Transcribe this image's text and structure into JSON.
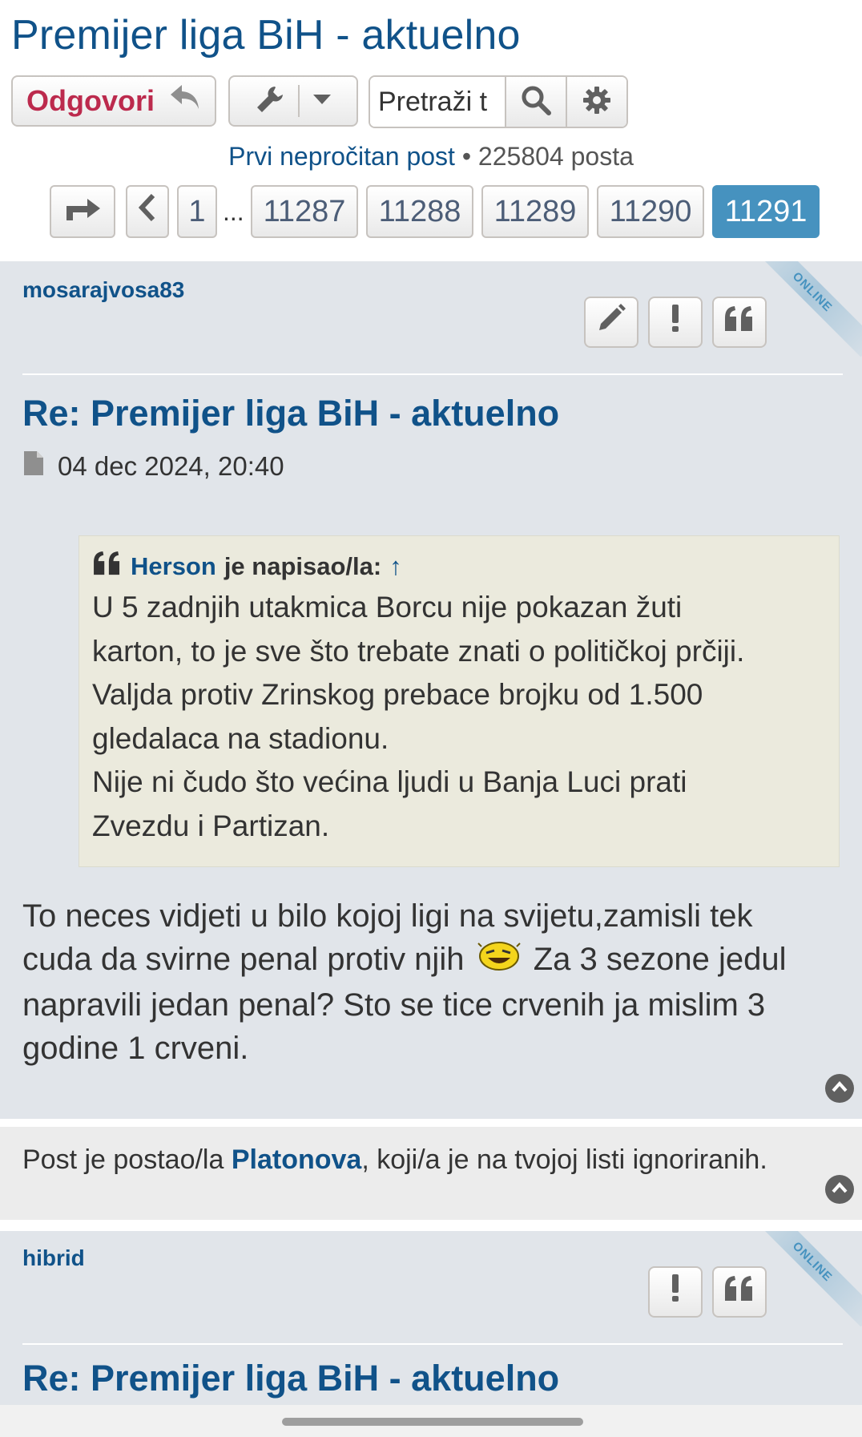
{
  "topic": {
    "title": "Premijer liga BiH - aktuelno"
  },
  "toolbar": {
    "reply_label": "Odgovori",
    "search_placeholder": "Pretraži t"
  },
  "stats": {
    "first_unread": "Prvi nepročitan post",
    "separator": "•",
    "post_count": "225804 posta"
  },
  "pagination": {
    "first_page": "1",
    "ellipsis": "...",
    "pages": [
      "11287",
      "11288",
      "11289",
      "11290",
      "11291"
    ],
    "current": "11291"
  },
  "posts": [
    {
      "author": "mosarajvosa83",
      "online_label": "ONLINE",
      "title": "Re: Premijer liga BiH - aktuelno",
      "datetime": "04 dec 2024, 20:40",
      "quote": {
        "author": "Herson",
        "wrote": "je napisao/la:",
        "arrow": "↑",
        "lines": [
          "U 5 zadnjih utakmica Borcu nije pokazan žuti",
          "karton, to je sve što trebate znati o političkoj prčiji.",
          "Valjda protiv Zrinskog prebace brojku od 1.500",
          "gledalaca na stadionu.",
          "Nije ni čudo što većina ljudi u Banja Luci prati",
          "Zvezdu i Partizan."
        ]
      },
      "body": {
        "line1": "To neces vidjeti u bilo kojoj ligi na svijetu,zamisli tek",
        "line2_before": "cuda da svirne penal protiv njih",
        "line2_after": "Za 3 sezone jedul",
        "line3": "napravili jedan penal? Sto se tice crvenih ja mislim 3",
        "line4": "godine 1 crveni."
      }
    },
    {
      "author": "hibrid",
      "online_label": "ONLINE",
      "title": "Re: Premijer liga BiH - aktuelno"
    }
  ],
  "ignored_post": {
    "before": "Post je postao/la",
    "user": "Platonova",
    "after": ", koji/a je na tvojoj listi ignoriranih."
  },
  "colors": {
    "link": "#105289",
    "reply": "#bc2a4d",
    "active_page": "#4692bf",
    "post_bg": "#e1e5ea",
    "quote_bg": "#ebeadd"
  }
}
